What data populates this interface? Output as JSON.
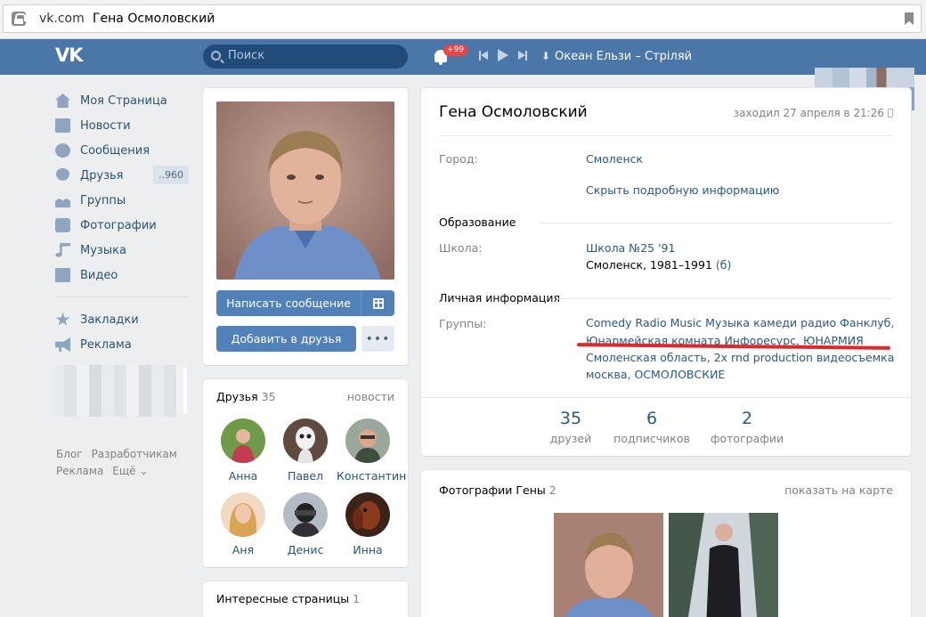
{
  "browser": {
    "domain": "vk.com",
    "title": "Гена Осмоловский"
  },
  "header": {
    "logo": "VK",
    "search_placeholder": "Поиск",
    "notifications": "+99",
    "track": "Океан Ельзи – Стріляй"
  },
  "menu": {
    "items": [
      {
        "label": "Моя Страница",
        "icon": "home-icon"
      },
      {
        "label": "Новости",
        "icon": "news-icon"
      },
      {
        "label": "Сообщения",
        "icon": "messages-icon"
      },
      {
        "label": "Друзья",
        "icon": "friends-icon",
        "count": "..960"
      },
      {
        "label": "Группы",
        "icon": "groups-icon"
      },
      {
        "label": "Фотографии",
        "icon": "camera-icon"
      },
      {
        "label": "Музыка",
        "icon": "music-icon"
      },
      {
        "label": "Видео",
        "icon": "video-icon"
      }
    ],
    "extra": [
      {
        "label": "Закладки",
        "icon": "star-icon"
      },
      {
        "label": "Реклама",
        "icon": "megaphone-icon"
      }
    ],
    "footer": [
      "Блог",
      "Разработчикам",
      "Реклама",
      "Ещё ⌄"
    ]
  },
  "profile_actions": {
    "send_message": "Написать сообщение",
    "add_friend": "Добавить в друзья",
    "more": "•••"
  },
  "friends": {
    "title": "Друзья",
    "count": "35",
    "news_link": "новости",
    "list": [
      "Анна",
      "Павел",
      "Константин",
      "Аня",
      "Денис",
      "Инна"
    ]
  },
  "pages": {
    "title": "Интересные страницы",
    "count": "1"
  },
  "info": {
    "name": "Гена Осмоловский",
    "last_seen": "заходил 27 апреля в 21:26",
    "city_label": "Город:",
    "city": "Смоленск",
    "hide_link": "Скрыть подробную информацию",
    "education_header": "Образование",
    "school_label": "Школа:",
    "school": "Школа №25 '91",
    "school_years": "Смоленск, 1981–1991",
    "school_class": "(б)",
    "personal_header": "Личная информация",
    "groups_label": "Группы:",
    "groups_line1": "Comedy Radio Music Музыка камеди радио Фанклуб,",
    "groups_line2": "Юнармейская комната Инфоресурс, ЮНАРМИЯ",
    "groups_line3": "Смоленская область, 2x rnd production видеосъемка",
    "groups_line4": "москва, ОСМОЛОВСКИЕ"
  },
  "stats": [
    {
      "num": "35",
      "label": "друзей"
    },
    {
      "num": "6",
      "label": "подписчиков"
    },
    {
      "num": "2",
      "label": "фотографии"
    }
  ],
  "photos": {
    "title": "Фотографии Гены",
    "count": "2",
    "map_link": "показать на карте"
  },
  "colors": {
    "header": "#4a76a8",
    "link": "#2a5885",
    "button": "#5181b8",
    "highlight": "#e0282b"
  }
}
